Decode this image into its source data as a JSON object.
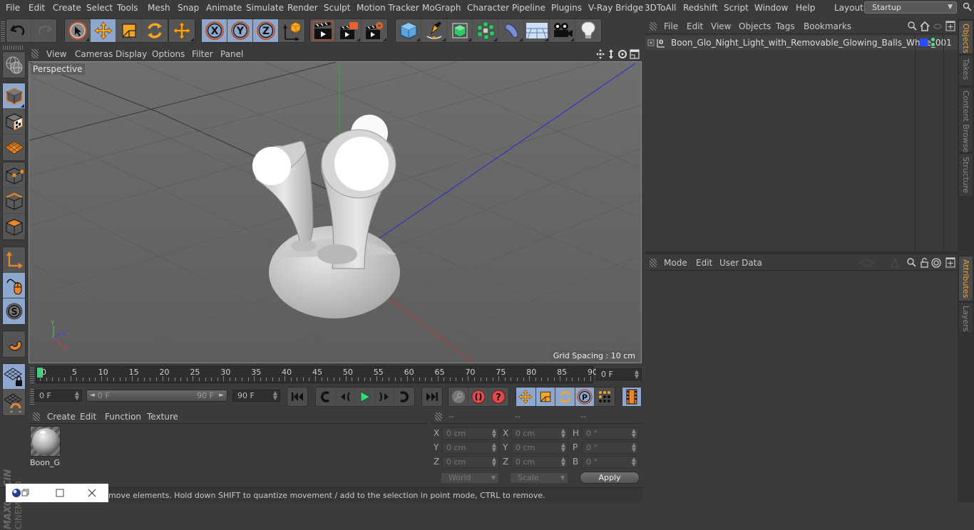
{
  "menubar": {
    "items": [
      "File",
      "Edit",
      "Create",
      "Select",
      "Tools",
      "Mesh",
      "Snap",
      "Animate",
      "Simulate",
      "Render",
      "Sculpt",
      "Motion Tracker",
      "MoGraph",
      "Character",
      "Pipeline",
      "Plugins",
      "V-Ray Bridge",
      "3DToAll",
      "Redshift",
      "Script",
      "Window",
      "Help"
    ],
    "layout_label": "Layout:",
    "layout_value": "Startup"
  },
  "toolbar": {
    "groups": [
      [
        "undo-icon",
        "redo-icon"
      ],
      [
        "live-selection-icon",
        "move-icon",
        "scale-icon",
        "rotate-icon"
      ],
      [
        "recent-tool-icon"
      ],
      [
        "x-axis-lock-icon",
        "y-axis-lock-icon",
        "z-axis-lock-icon",
        "coordinate-system-icon"
      ],
      [
        "render-view-icon",
        "render-picture-viewer-icon",
        "render-settings-icon"
      ],
      [
        "cube-object-icon",
        "pen-spline-icon",
        "subdivision-surface-icon",
        "cloner-icon",
        "bend-deformer-icon",
        "floor-environment-icon",
        "camera-icon",
        "light-icon"
      ]
    ]
  },
  "left_palette": [
    "make-editable-icon",
    "model-mode-icon",
    "texture-mode-icon",
    "workplane-mode-icon",
    "points-mode-icon",
    "edges-mode-icon",
    "polygons-mode-icon",
    "enable-axis-icon",
    "tweak-mode-icon",
    "solo-mode-icon",
    "snapping-icon",
    "locked-workplane-icon",
    "planar-workplane-icon"
  ],
  "brand": "MAXON CINEMA 4D",
  "viewport": {
    "menu": [
      "View",
      "Cameras",
      "Display",
      "Options",
      "Filter",
      "Panel"
    ],
    "camera_label": "Perspective",
    "grid_spacing": "Grid Spacing : 10 cm",
    "axis_labels": {
      "x": "X",
      "y": "Y",
      "z": "Z"
    }
  },
  "timeline": {
    "ticks": [
      "0",
      "5",
      "10",
      "15",
      "20",
      "25",
      "30",
      "35",
      "40",
      "45",
      "50",
      "55",
      "60",
      "65",
      "70",
      "75",
      "80",
      "85",
      "90"
    ],
    "current_frame": "0 F",
    "start_field": "0 F",
    "range_start": "0 F",
    "range_end": "90 F",
    "end_field": "90 F",
    "playhead_frame": 0,
    "max_frame": 90
  },
  "material_manager": {
    "menu": [
      "Create",
      "Edit",
      "Function",
      "Texture"
    ],
    "materials": [
      {
        "name": "Boon_G"
      }
    ]
  },
  "coordinates": {
    "headers": [
      "--",
      "--",
      "--"
    ],
    "position": [
      {
        "axis": "X",
        "value": "0 cm"
      },
      {
        "axis": "Y",
        "value": "0 cm"
      },
      {
        "axis": "Z",
        "value": "0 cm"
      }
    ],
    "size": [
      {
        "axis": "X",
        "value": "0 cm"
      },
      {
        "axis": "Y",
        "value": "0 cm"
      },
      {
        "axis": "Z",
        "value": "0 cm"
      }
    ],
    "rotation": [
      {
        "axis": "H",
        "value": "0 °"
      },
      {
        "axis": "P",
        "value": "0 °"
      },
      {
        "axis": "B",
        "value": "0 °"
      }
    ],
    "space_dropdown": "World",
    "mode_dropdown": "Scale",
    "apply_label": "Apply"
  },
  "status": {
    "text": "move elements. Hold down SHIFT to quantize movement / add to the selection in point mode, CTRL to remove."
  },
  "object_manager": {
    "menu": [
      "File",
      "Edit",
      "View",
      "Objects",
      "Tags",
      "Bookmarks"
    ],
    "objects": [
      {
        "name": "Boon_Glo_Night_Light_with_Removable_Glowing_Balls_White_001",
        "layer_color": "#2a4bff",
        "visibility_color": "#4fe08a"
      }
    ]
  },
  "attribute_manager": {
    "menu": [
      "Mode",
      "Edit",
      "User Data"
    ]
  },
  "right_tabs": {
    "top": [
      {
        "label": "Objects",
        "selected": true
      },
      {
        "label": "Takes",
        "selected": false
      },
      {
        "label": "Content Browser",
        "selected": false
      },
      {
        "label": "Structure",
        "selected": false
      }
    ],
    "bottom": [
      {
        "label": "Attributes",
        "selected": true
      },
      {
        "label": "Layers",
        "selected": false
      }
    ]
  },
  "colors": {
    "accent_orange": "#e8a13a",
    "active_blue": "#8ea7cf",
    "playhead_green": "#3ed07b"
  }
}
